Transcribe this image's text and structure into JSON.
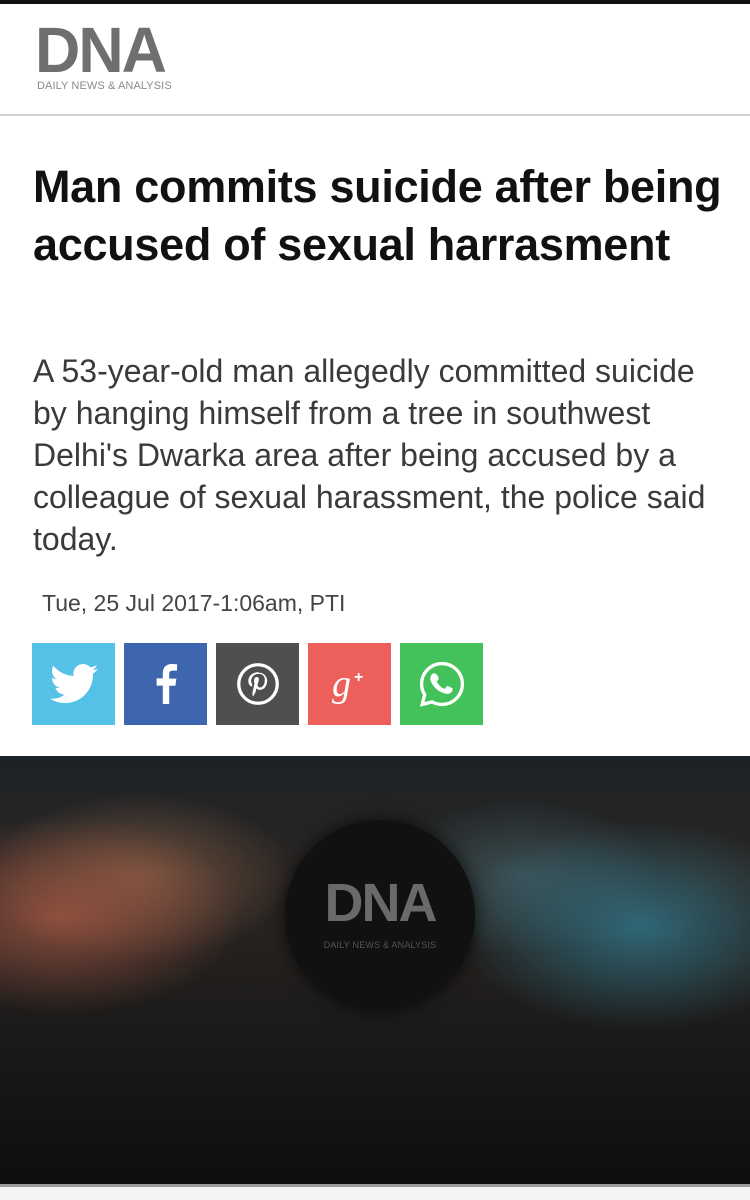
{
  "masthead": {
    "logo_main": "DNA",
    "logo_sub": "DAILY NEWS & ANALYSIS"
  },
  "article": {
    "headline": "Man commits suicide after being accused of sexual harrasment",
    "summary": "A 53-year-old man allegedly committed suicide by hanging himself from a tree in southwest Delhi's Dwarka area after being accused by a colleague of sexual harassment, the police said today.",
    "meta": "Tue, 25 Jul 2017-1:06am, PTI"
  },
  "share": [
    {
      "name": "twitter",
      "icon": "twitter-icon",
      "color": "#55c1e6"
    },
    {
      "name": "facebook",
      "icon": "facebook-icon",
      "color": "#3d66ae"
    },
    {
      "name": "pinterest",
      "icon": "pinterest-icon",
      "color": "#4f4f4f"
    },
    {
      "name": "google-plus",
      "icon": "google-plus-icon",
      "color": "#ec5f5b"
    },
    {
      "name": "whatsapp",
      "icon": "whatsapp-icon",
      "color": "#43c15a"
    }
  ],
  "video": {
    "logo_main": "DNA",
    "logo_sub": "DAILY NEWS & ANALYSIS"
  }
}
